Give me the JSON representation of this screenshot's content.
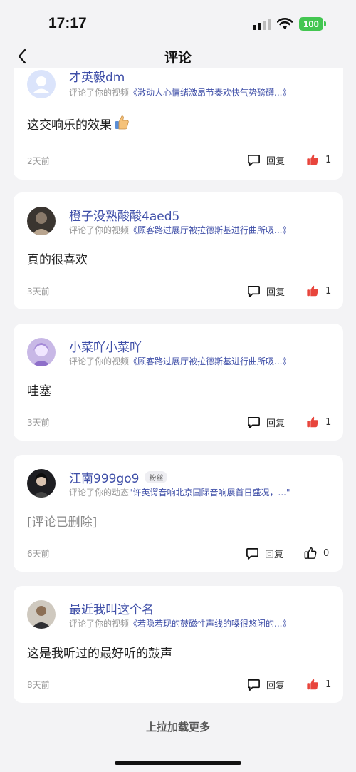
{
  "status_bar": {
    "time": "17:17",
    "battery": "100"
  },
  "nav": {
    "title": "评论"
  },
  "comments": [
    {
      "username": "才英毅dm",
      "meta_prefix": "评论了你的视频",
      "target": "《激动人心情绪激昂节奏欢快气势磅礴...》",
      "content": "这交响乐的效果",
      "time": "2天前",
      "reply_label": "回复",
      "likes": "1"
    },
    {
      "username": "橙子没熟酸酸4aed5",
      "meta_prefix": "评论了你的视频",
      "target": "《顾客路过展厅被拉德斯基进行曲所吸...》",
      "content": "真的很喜欢",
      "time": "3天前",
      "reply_label": "回复",
      "likes": "1"
    },
    {
      "username": "小菜吖小菜吖",
      "meta_prefix": "评论了你的视频",
      "target": "《顾客路过展厅被拉德斯基进行曲所吸...》",
      "content": "哇塞",
      "time": "3天前",
      "reply_label": "回复",
      "likes": "1"
    },
    {
      "username": "江南999go9",
      "badge": "粉丝",
      "meta_prefix": "评论了你的动态",
      "target": "\"许英谔音响北京国际音响展首日盛况，...\"",
      "content": "[评论已删除]",
      "time": "6天前",
      "reply_label": "回复",
      "likes": "0"
    },
    {
      "username": "最近我叫这个名",
      "meta_prefix": "评论了你的视频",
      "target": "《若隐若现的鼓磁性声线的嗓很悠闲的...》",
      "content": "这是我听过的最好听的鼓声",
      "time": "8天前",
      "reply_label": "回复",
      "likes": "1"
    }
  ],
  "load_more": "上拉加载更多",
  "icons": {
    "reply": "comment-bubble-icon",
    "liked": "thumbs-up-filled-icon",
    "unliked": "thumbs-up-outline-icon",
    "back": "chevron-left-icon"
  },
  "colors": {
    "link": "#3f4fa8",
    "like": "#e8453c",
    "battery": "#43c651"
  }
}
